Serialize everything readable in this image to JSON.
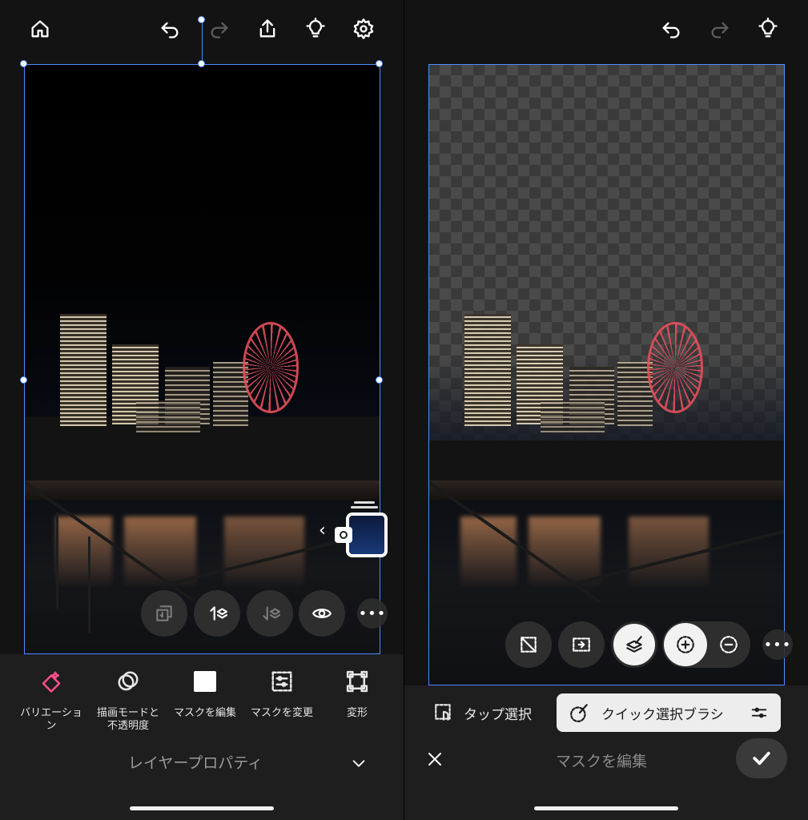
{
  "left": {
    "toolbar": {
      "home": "home-icon",
      "undo": "undo-icon",
      "redo": "redo-icon",
      "share": "share-icon",
      "tips": "lightbulb-icon",
      "settings": "gear-icon"
    },
    "layer_actions": [
      "merge-down",
      "move-up",
      "move-down",
      "visibility",
      "more"
    ],
    "tools": [
      {
        "label": "バリエーショ\nン",
        "icon": "variation-icon",
        "accent": "#ff4d8d"
      },
      {
        "label": "描画モードと\n不透明度",
        "icon": "blend-mode-icon"
      },
      {
        "label": "マスクを編集",
        "icon": "mask-icon"
      },
      {
        "label": "マスクを変更",
        "icon": "mask-adjust-icon"
      },
      {
        "label": "変形",
        "icon": "transform-icon"
      }
    ],
    "footer_title": "レイヤープロパティ",
    "footer_toggle": "chevron-down-icon"
  },
  "right": {
    "toolbar": {
      "undo": "undo-icon",
      "redo": "redo-icon",
      "tips": "lightbulb-icon"
    },
    "mask_actions": [
      "clear-selection",
      "invert",
      "brush-fill",
      "add",
      "subtract",
      "more"
    ],
    "select_tools": {
      "tap": "タップ選択",
      "quick": "クイック選択ブラシ"
    },
    "footer_title": "マスクを編集",
    "accent": "#4c8dff"
  }
}
